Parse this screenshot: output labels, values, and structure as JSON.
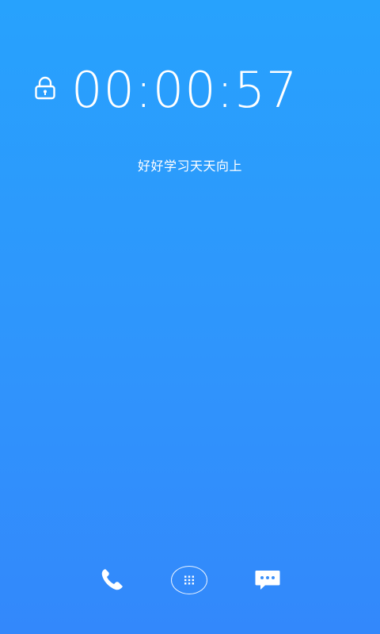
{
  "lockscreen": {
    "timer": "00:00:57",
    "motto": "好好学习天天向上"
  },
  "icons": {
    "lock": "lock-icon",
    "phone": "phone-icon",
    "apps": "app-grid-icon",
    "messages": "message-bubble-icon"
  },
  "colors": {
    "background_top": "#27a2fd",
    "background_bottom": "#3388fb",
    "foreground": "#ffffff"
  }
}
